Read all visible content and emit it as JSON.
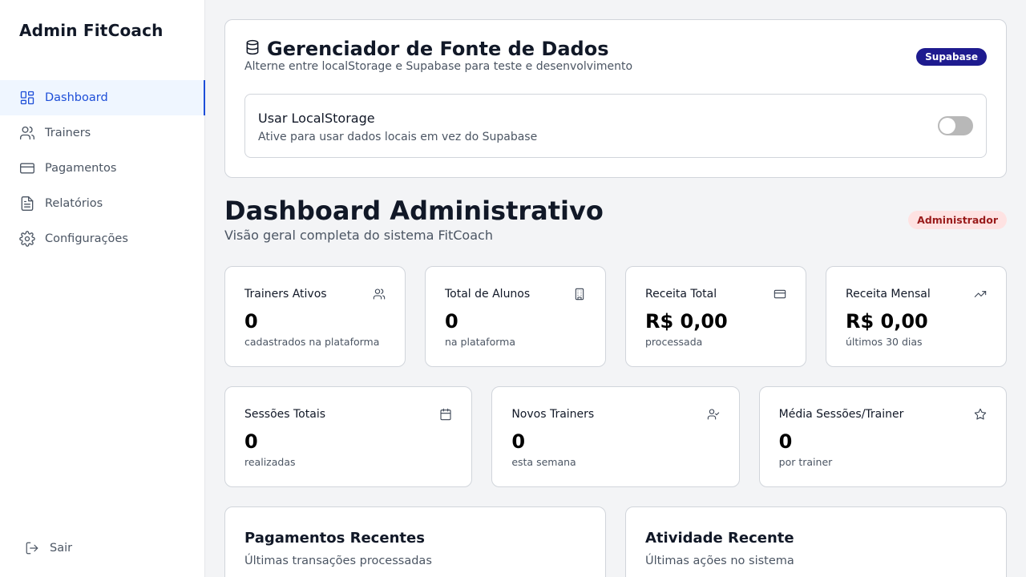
{
  "sidebar": {
    "brand": "Admin FitCoach",
    "items": [
      {
        "label": "Dashboard",
        "icon": "dashboard-icon",
        "active": true
      },
      {
        "label": "Trainers",
        "icon": "users-icon"
      },
      {
        "label": "Pagamentos",
        "icon": "credit-card-icon"
      },
      {
        "label": "Relatórios",
        "icon": "file-text-icon"
      },
      {
        "label": "Configurações",
        "icon": "gear-icon"
      }
    ],
    "logout": {
      "label": "Sair",
      "icon": "logout-icon"
    }
  },
  "datasource": {
    "title": "Gerenciador de Fonte de Dados",
    "icon": "database-icon",
    "subtitle": "Alterne entre localStorage e Supabase para teste e desenvolvimento",
    "badge": "Supabase",
    "toggle_title": "Usar LocalStorage",
    "toggle_subtitle": "Ative para usar dados locais em vez do Supabase",
    "toggle_on": false
  },
  "dashboard": {
    "title": "Dashboard Administrativo",
    "subtitle": "Visão geral completa do sistema FitCoach",
    "role_badge": "Administrador"
  },
  "stats_row1": [
    {
      "label": "Trainers Ativos",
      "value": "0",
      "sub": "cadastrados na plataforma",
      "icon": "users-icon"
    },
    {
      "label": "Total de Alunos",
      "value": "0",
      "sub": "na plataforma",
      "icon": "building-icon"
    },
    {
      "label": "Receita Total",
      "value": "R$ 0,00",
      "sub": "processada",
      "icon": "credit-card-icon"
    },
    {
      "label": "Receita Mensal",
      "value": "R$ 0,00",
      "sub": "últimos 30 dias",
      "icon": "trending-up-icon"
    }
  ],
  "stats_row2": [
    {
      "label": "Sessões Totais",
      "value": "0",
      "sub": "realizadas",
      "icon": "calendar-icon"
    },
    {
      "label": "Novos Trainers",
      "value": "0",
      "sub": "esta semana",
      "icon": "user-check-icon"
    },
    {
      "label": "Média Sessões/Trainer",
      "value": "0",
      "sub": "por trainer",
      "icon": "star-icon"
    }
  ],
  "recent_payments": {
    "title": "Pagamentos Recentes",
    "subtitle": "Últimas transações processadas"
  },
  "recent_activity": {
    "title": "Atividade Recente",
    "subtitle": "Últimas ações no sistema"
  },
  "colors": {
    "accent": "#1d4ed8",
    "supabase_badge": "#1e1b8f",
    "admin_badge_bg": "#fee2e2",
    "admin_badge_text": "#991b1b"
  }
}
